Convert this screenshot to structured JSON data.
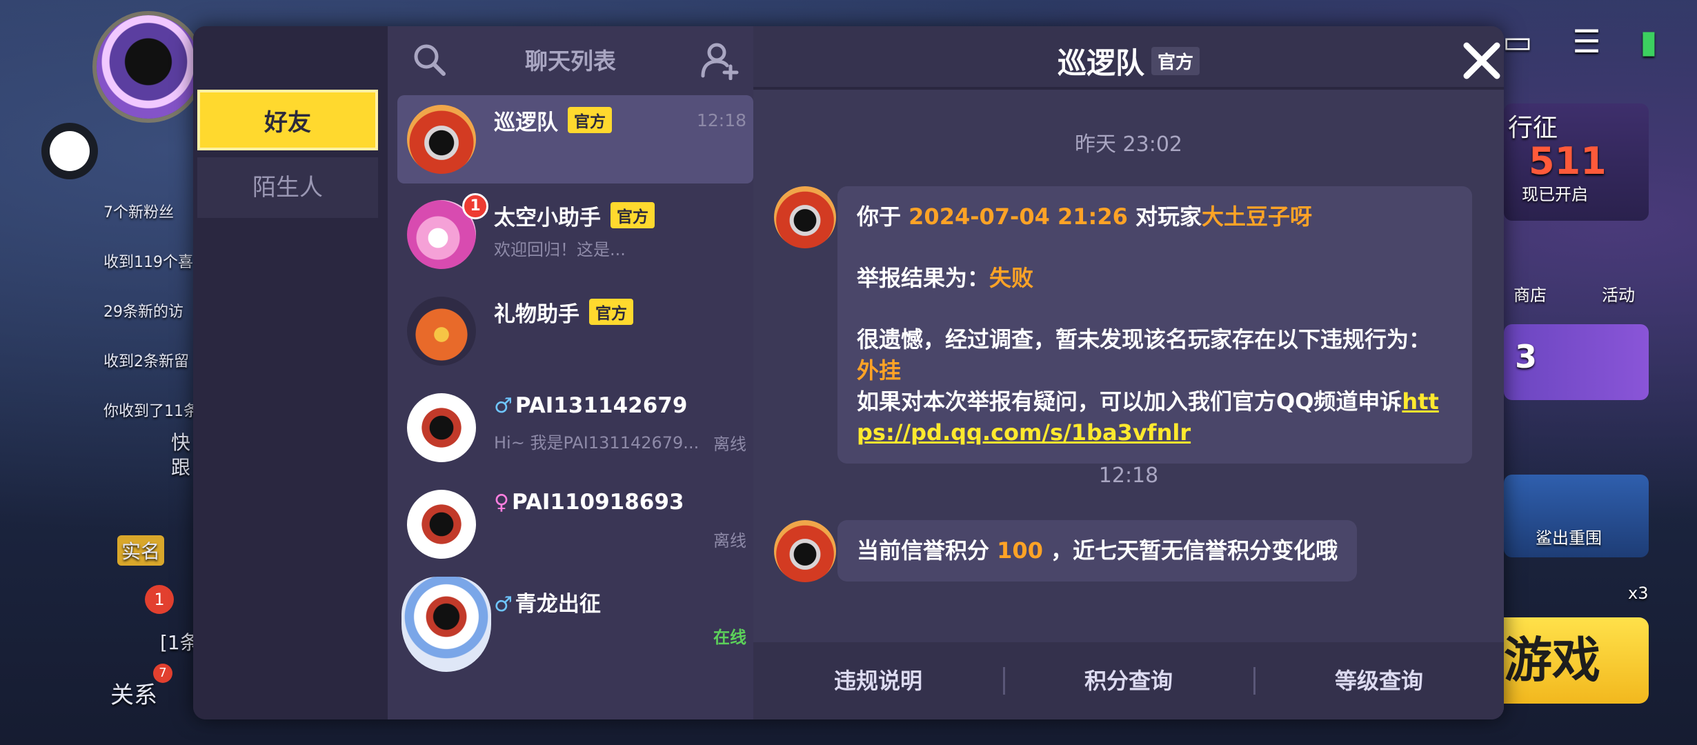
{
  "background": {
    "left_notices": [
      "7个新粉丝",
      "收到119个喜",
      "29条新的访",
      "收到2条新留",
      "你收到了11条"
    ],
    "left_labels": [
      "快",
      "跟",
      "实名",
      "[1条"
    ],
    "bottom_left_label": "关系",
    "bottom_left_badge": "7",
    "left_badge": "1",
    "right_pass_title": "行征",
    "right_pass_level": "511",
    "right_pass_sub": "现已开启",
    "right_shop": "商店",
    "right_activity": "活动",
    "right_level_num": "3",
    "right_event": "鲨出重围",
    "right_star_count": "x3",
    "right_button": "游戏"
  },
  "tabs": {
    "friends": "好友",
    "strangers": "陌生人"
  },
  "chat_list": {
    "title": "聊天列表",
    "items": [
      {
        "name": "巡逻队",
        "official": "官方",
        "time": "12:18",
        "preview": "",
        "status": ""
      },
      {
        "name": "太空小助手",
        "official": "官方",
        "badge": "1",
        "preview": "欢迎回归！这是...",
        "status": ""
      },
      {
        "name": "礼物助手",
        "official": "官方",
        "preview": "",
        "status": ""
      },
      {
        "gender": "♂",
        "name": "PAI131142679",
        "preview": "Hi~ 我是PAI131142679...",
        "status": "离线"
      },
      {
        "gender": "♀",
        "name": "PAI110918693",
        "preview": "",
        "status": "离线"
      },
      {
        "gender": "♂",
        "name": "青龙出征",
        "preview": "",
        "status": "在线"
      }
    ]
  },
  "chat": {
    "title": "巡逻队",
    "official": "官方",
    "timestamp1": "昨天 23:02",
    "msg1": {
      "p1_a": "你于 ",
      "p1_time": "2024-07-04 21:26",
      "p1_b": " 对玩家",
      "p1_player": "大土豆子呀",
      "p2_a": "举报结果为：",
      "p2_result": "失败",
      "p3_a": "很遗憾，经过调查，暂未发现该名玩家存在以下违规行为：",
      "p3_violation": "外挂",
      "p4_a": "如果对本次举报有疑问，可以加入我们官方QQ频道申诉",
      "p4_link": "https://pd.qq.com/s/1ba3vfnlr"
    },
    "timestamp2": "12:18",
    "msg2": {
      "a": "当前信誉积分 ",
      "score": "100",
      "b": " ，近七天暂无信誉积分变化哦"
    },
    "footer": [
      "违规说明",
      "积分查询",
      "等级查询"
    ]
  },
  "colors": {
    "accent_yellow": "#ffd92e",
    "highlight_orange": "#ffa326",
    "online_green": "#5cd05a",
    "dialog_bg": "#2f2b45"
  }
}
